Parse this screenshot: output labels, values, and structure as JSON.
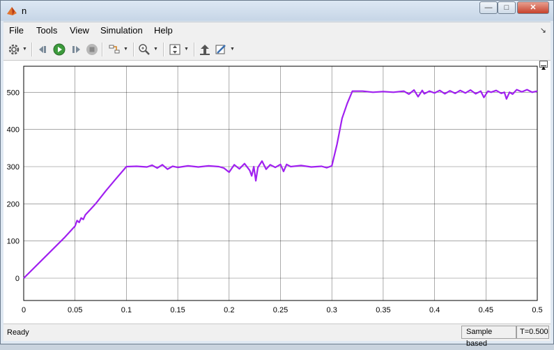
{
  "window": {
    "title": "n"
  },
  "menu": {
    "file": "File",
    "tools": "Tools",
    "view": "View",
    "simulation": "Simulation",
    "help": "Help"
  },
  "toolbar": {
    "icons": [
      "gear-icon",
      "step-back-icon",
      "run-icon",
      "step-forward-icon",
      "stop-icon",
      "signal-select-icon",
      "zoom-icon",
      "autoscale-icon",
      "highlight-block-icon",
      "style-icon"
    ]
  },
  "status": {
    "ready": "Ready",
    "sample_mode": "Sample based",
    "time": "T=0.500"
  },
  "colors": {
    "signal": "#a020f0",
    "grid": "#000000",
    "background": "#ffffff"
  },
  "chart_data": {
    "type": "line",
    "title": "",
    "xlabel": "",
    "ylabel": "",
    "xlim": [
      0,
      0.5
    ],
    "ylim": [
      -60,
      570
    ],
    "grid": true,
    "xticks": [
      "0",
      "0.05",
      "0.1",
      "0.15",
      "0.2",
      "0.25",
      "0.3",
      "0.35",
      "0.4",
      "0.45",
      "0.5"
    ],
    "yticks": [
      "0",
      "100",
      "200",
      "300",
      "400",
      "500"
    ],
    "series": [
      {
        "name": "",
        "color": "#a020f0",
        "points": [
          [
            0,
            0
          ],
          [
            0.02,
            55
          ],
          [
            0.04,
            110
          ],
          [
            0.05,
            140
          ],
          [
            0.052,
            155
          ],
          [
            0.054,
            150
          ],
          [
            0.056,
            162
          ],
          [
            0.058,
            158
          ],
          [
            0.06,
            170
          ],
          [
            0.07,
            200
          ],
          [
            0.08,
            235
          ],
          [
            0.09,
            268
          ],
          [
            0.1,
            300
          ],
          [
            0.11,
            301
          ],
          [
            0.12,
            299
          ],
          [
            0.125,
            304
          ],
          [
            0.13,
            296
          ],
          [
            0.135,
            305
          ],
          [
            0.14,
            293
          ],
          [
            0.145,
            301
          ],
          [
            0.15,
            298
          ],
          [
            0.16,
            302
          ],
          [
            0.17,
            299
          ],
          [
            0.18,
            302
          ],
          [
            0.19,
            300
          ],
          [
            0.195,
            296
          ],
          [
            0.2,
            285
          ],
          [
            0.205,
            305
          ],
          [
            0.21,
            294
          ],
          [
            0.215,
            308
          ],
          [
            0.22,
            290
          ],
          [
            0.222,
            275
          ],
          [
            0.224,
            300
          ],
          [
            0.226,
            262
          ],
          [
            0.228,
            298
          ],
          [
            0.232,
            315
          ],
          [
            0.236,
            293
          ],
          [
            0.24,
            305
          ],
          [
            0.245,
            298
          ],
          [
            0.25,
            306
          ],
          [
            0.253,
            287
          ],
          [
            0.256,
            306
          ],
          [
            0.26,
            300
          ],
          [
            0.27,
            303
          ],
          [
            0.28,
            299
          ],
          [
            0.29,
            301
          ],
          [
            0.295,
            297
          ],
          [
            0.3,
            302
          ],
          [
            0.305,
            360
          ],
          [
            0.31,
            430
          ],
          [
            0.315,
            470
          ],
          [
            0.32,
            503
          ],
          [
            0.33,
            503
          ],
          [
            0.34,
            500
          ],
          [
            0.35,
            502
          ],
          [
            0.36,
            500
          ],
          [
            0.37,
            503
          ],
          [
            0.375,
            495
          ],
          [
            0.38,
            506
          ],
          [
            0.384,
            488
          ],
          [
            0.388,
            505
          ],
          [
            0.39,
            496
          ],
          [
            0.395,
            503
          ],
          [
            0.4,
            498
          ],
          [
            0.405,
            505
          ],
          [
            0.41,
            496
          ],
          [
            0.415,
            504
          ],
          [
            0.42,
            497
          ],
          [
            0.425,
            505
          ],
          [
            0.43,
            498
          ],
          [
            0.435,
            506
          ],
          [
            0.44,
            496
          ],
          [
            0.445,
            503
          ],
          [
            0.448,
            486
          ],
          [
            0.452,
            503
          ],
          [
            0.455,
            500
          ],
          [
            0.46,
            505
          ],
          [
            0.465,
            497
          ],
          [
            0.468,
            500
          ],
          [
            0.47,
            482
          ],
          [
            0.473,
            500
          ],
          [
            0.476,
            495
          ],
          [
            0.48,
            507
          ],
          [
            0.485,
            501
          ],
          [
            0.49,
            507
          ],
          [
            0.495,
            500
          ],
          [
            0.5,
            503
          ]
        ]
      }
    ]
  }
}
